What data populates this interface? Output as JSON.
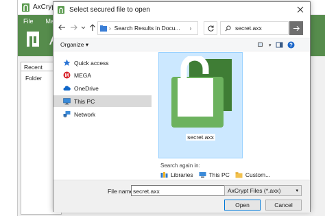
{
  "background_app": {
    "title": "AxCrypt",
    "menu": [
      "File",
      "Ma"
    ],
    "banner_text": "A",
    "tab_recent": "Recent Files",
    "column_folder": "Folder",
    "brand_color": "#568c4c"
  },
  "dialog": {
    "title": "Select secured file to open",
    "close_icon": "close-icon",
    "address": "Search Results in Docu...",
    "search_value": "secret.axx",
    "organize_label": "Organize",
    "nav_items": [
      {
        "label": "Quick access",
        "icon": "star-icon"
      },
      {
        "label": "MEGA",
        "icon": "mega-icon"
      },
      {
        "label": "OneDrive",
        "icon": "cloud-icon"
      },
      {
        "label": "This PC",
        "icon": "computer-icon"
      },
      {
        "label": "Network",
        "icon": "network-icon"
      }
    ],
    "selected_nav": "This PC",
    "file": {
      "name": "secret.axx"
    },
    "search_again_label": "Search again in:",
    "search_again_items": [
      {
        "label": "Libraries",
        "icon": "libraries-icon"
      },
      {
        "label": "This PC",
        "icon": "computer-icon"
      },
      {
        "label": "Custom...",
        "icon": "folder-icon"
      }
    ],
    "filename_label": "File name:",
    "filename_value": "secret.axx",
    "filetype_value": "AxCrypt Files (*.axx)",
    "open_label": "Open",
    "cancel_label": "Cancel",
    "selection_color": "#cce8ff"
  }
}
